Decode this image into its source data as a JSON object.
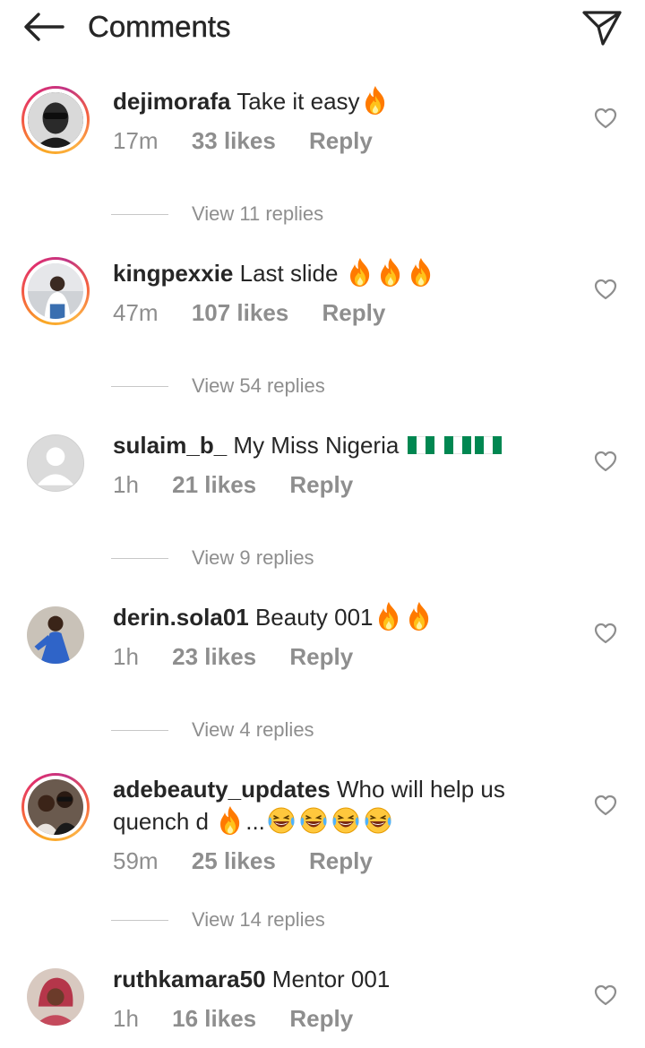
{
  "header": {
    "title": "Comments",
    "back_icon": "arrow-left-icon",
    "share_icon": "paper-plane-icon"
  },
  "colors": {
    "text": "#262626",
    "muted": "#8e8e8e",
    "story_ring": "#e1306c",
    "fire": "#ff7a00"
  },
  "comments": [
    {
      "username": "dejimorafa",
      "text": "Take it easy",
      "emojis": [
        "fire"
      ],
      "time": "17m",
      "likes": "33 likes",
      "reply": "Reply",
      "view_replies": "View 11 replies",
      "story_ring": true
    },
    {
      "username": "kingpexxie",
      "text": "Last slide",
      "emojis": [
        "fire",
        "fire",
        "fire"
      ],
      "time": "47m",
      "likes": "107 likes",
      "reply": "Reply",
      "view_replies": "View 54 replies",
      "story_ring": true
    },
    {
      "username": "sulaim_b_",
      "text": "My Miss Nigeria",
      "emojis": [
        "flag-nigeria",
        "flag-nigeria",
        "flag-nigeria"
      ],
      "time": "1h",
      "likes": "21 likes",
      "reply": "Reply",
      "view_replies": "View 9 replies",
      "story_ring": false
    },
    {
      "username": "derin.sola01",
      "text": "Beauty 001",
      "emojis": [
        "fire",
        "fire"
      ],
      "time": "1h",
      "likes": "23 likes",
      "reply": "Reply",
      "view_replies": "View 4 replies",
      "story_ring": false
    },
    {
      "username": "adebeauty_updates",
      "text": "Who will help us quench d",
      "text_suffix": "...",
      "emojis": [
        "fire",
        "laughing-crying",
        "laughing-crying",
        "laughing-crying",
        "laughing-crying"
      ],
      "time": "59m",
      "likes": "25 likes",
      "reply": "Reply",
      "view_replies": "View 14 replies",
      "story_ring": true
    },
    {
      "username": "ruthkamara50",
      "text": "Mentor 001",
      "emojis": [],
      "time": "1h",
      "likes": "16 likes",
      "reply": "Reply",
      "story_ring": false
    }
  ]
}
